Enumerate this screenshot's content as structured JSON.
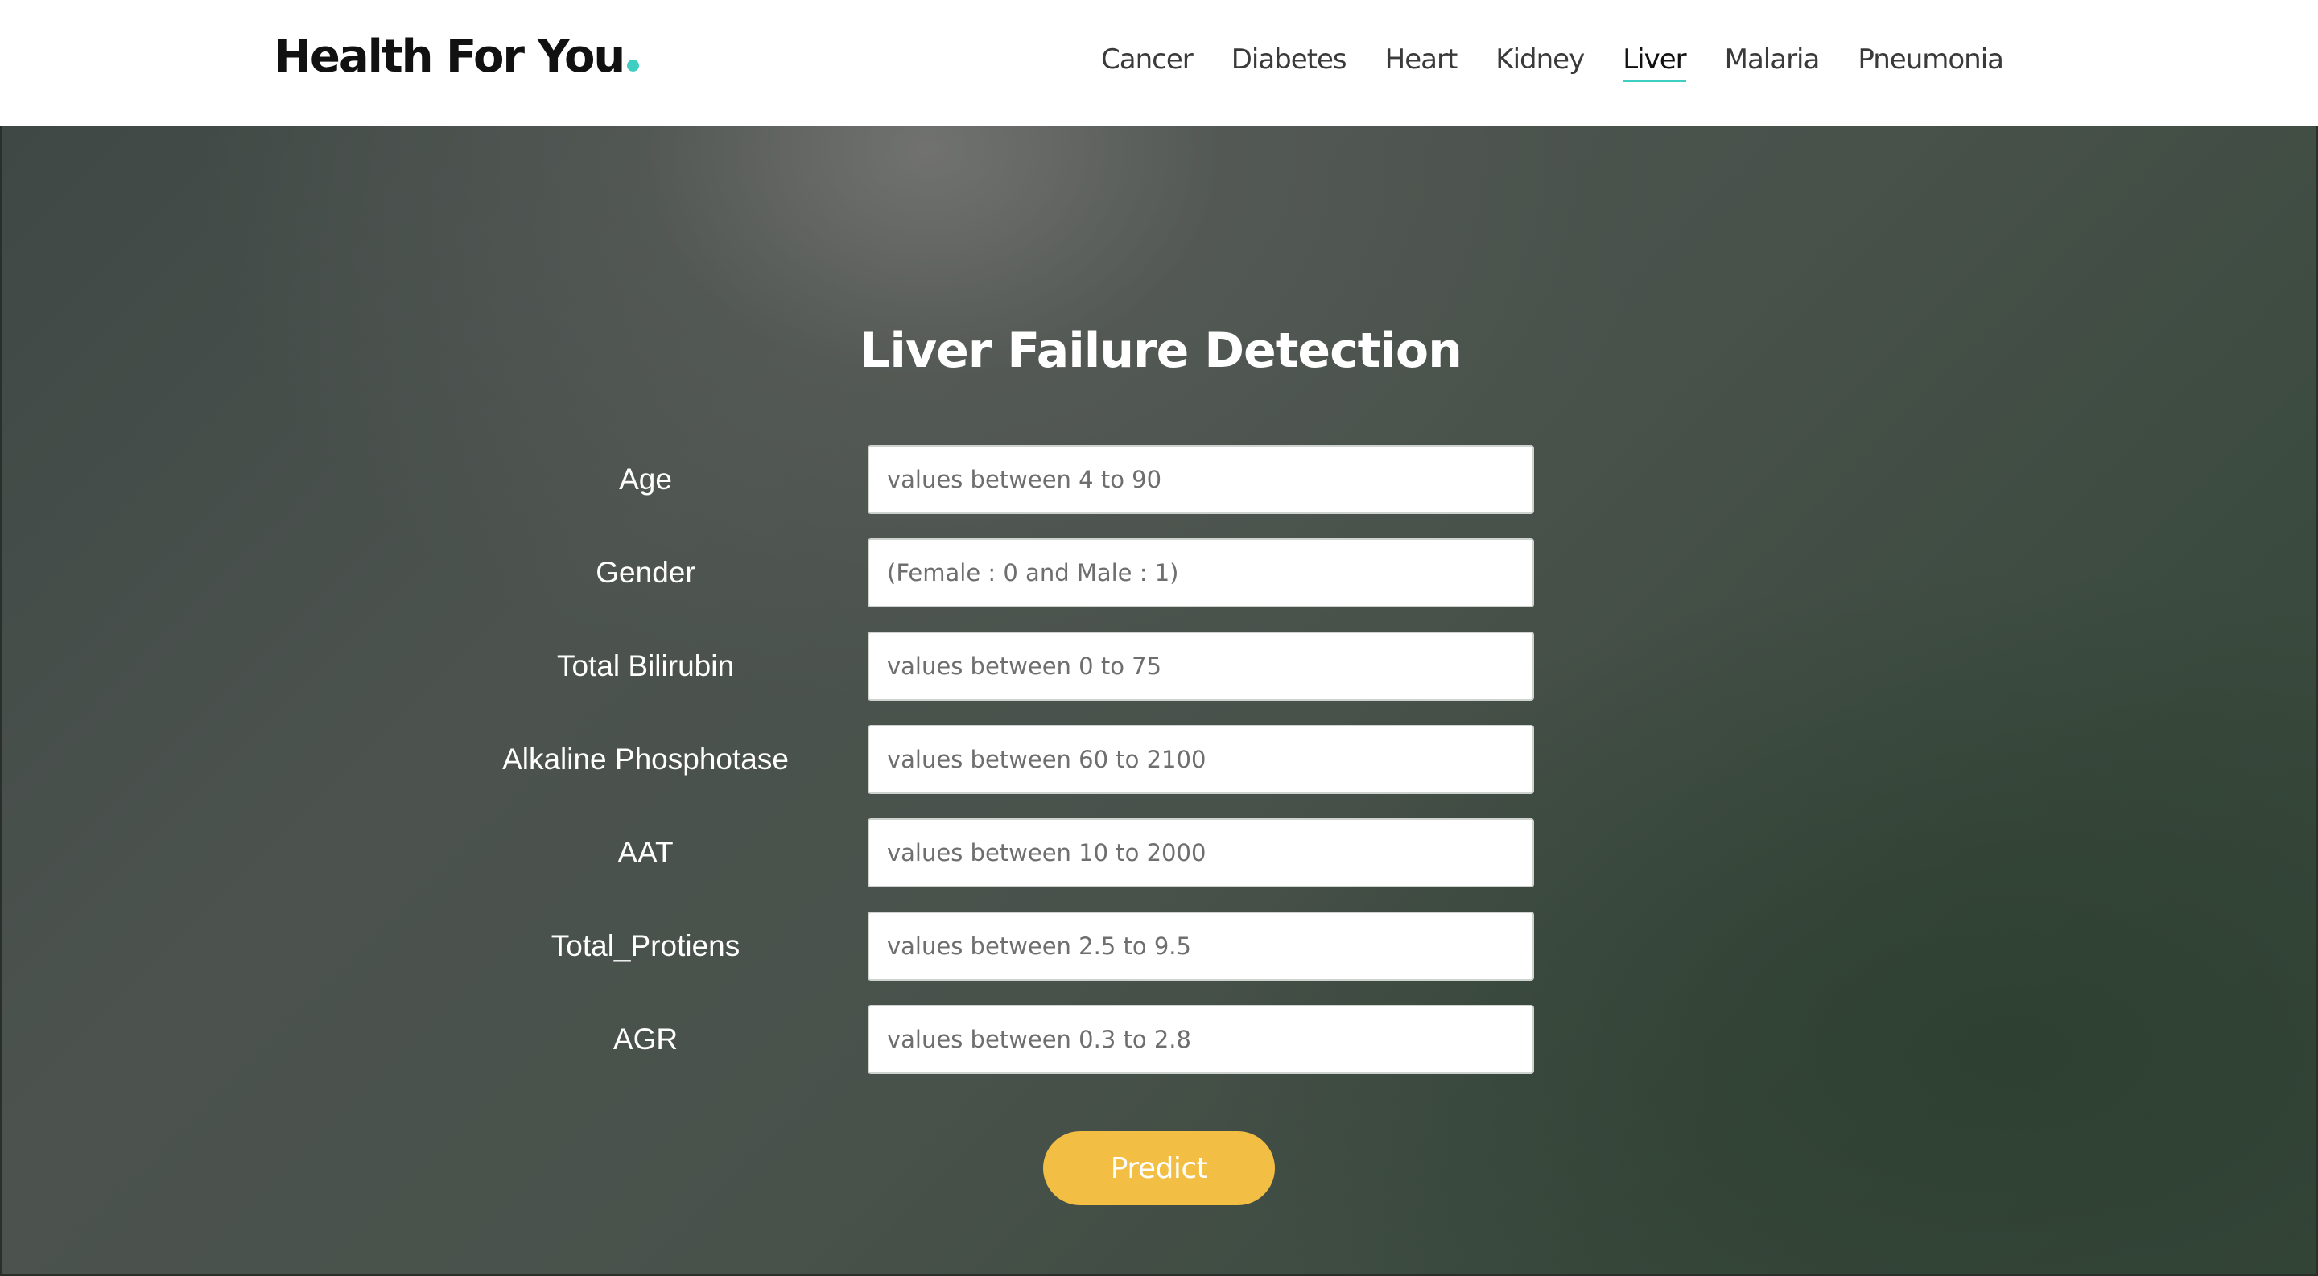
{
  "header": {
    "logo_text": "Health For You",
    "logo_dot_color": "#3ecfc2",
    "nav": [
      {
        "label": "Cancer"
      },
      {
        "label": "Diabetes"
      },
      {
        "label": "Heart"
      },
      {
        "label": "Kidney"
      },
      {
        "label": "Liver",
        "active": true
      },
      {
        "label": "Malaria"
      },
      {
        "label": "Pneumonia"
      }
    ]
  },
  "main": {
    "title": "Liver Failure Detection",
    "fields": [
      {
        "label": "Age",
        "placeholder": "values between 4 to 90",
        "value": ""
      },
      {
        "label": "Gender",
        "placeholder": "(Female : 0 and Male : 1)",
        "value": ""
      },
      {
        "label": "Total Bilirubin",
        "placeholder": "values between 0 to 75",
        "value": ""
      },
      {
        "label": "Alkaline Phosphotase",
        "placeholder": "values between 60 to 2100",
        "value": ""
      },
      {
        "label": "AAT",
        "placeholder": "values between 10 to 2000",
        "value": ""
      },
      {
        "label": "Total_Protiens",
        "placeholder": "values between 2.5 to 9.5",
        "value": ""
      },
      {
        "label": "AGR",
        "placeholder": "values between 0.3 to 2.8",
        "value": ""
      }
    ],
    "predict_label": "Predict",
    "predict_color": "#f3be44"
  }
}
